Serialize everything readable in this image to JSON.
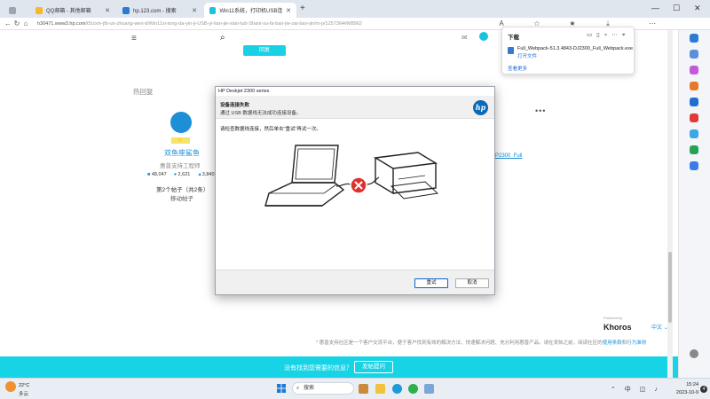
{
  "browser": {
    "tabs": [
      {
        "label": "QQ邮箱 - 其他邮箱",
        "color": "#f6b72a"
      },
      {
        "label": "hp.123.com - 搜索",
        "color": "#2a7ad6"
      },
      {
        "label": "Win11系统，打印机USB连接断开...",
        "color": "#19c3db"
      }
    ],
    "new_tab": "+",
    "url_host": "h30471.www3.hp.com",
    "url_rest": "/t5/zxm-jtb-un-zhuang-wen-ti/Win11xi-tong-da-yin-ji-USB-yi-lian-jie-xian-tub-Shani-su-fa-ban-jie-zai-ban-jin/m-p/1257364#M8962",
    "window_controls": [
      "—",
      "☐",
      "✕"
    ]
  },
  "downloads": {
    "title": "下载",
    "file_name": "Full_Webpack-51.3.4843-DJ2300_Full_Webpack.exe",
    "open_file": "打开文件",
    "see_more": "查看更多"
  },
  "page": {
    "top_button": "回复",
    "section_title": "热回复",
    "user": {
      "badge": "⭐",
      "name": "双鱼座鲨鱼",
      "title": "惠普支持工程师",
      "stats": [
        "48,047",
        "2,621",
        "3,840"
      ],
      "posts": "第2个帖子（共2条）",
      "solved": "移动帖子"
    },
    "more_dots": "•••",
    "link_fragment": "P2300_Full",
    "khoros_pre": "Powered by",
    "khoros": "Khoros",
    "language": "中文",
    "footer_note": "* 惠普支持社区是一个客户交流平台，便于客户找到有效的解决方法、快速解决问题、充分利用惠普产品。请在发帖之前，阅读社区的",
    "footer_link1": "使用条款",
    "footer_and": "和",
    "footer_link2": "行为准则",
    "question": "没有找到您需要的信息？",
    "post_button": "发帖提问"
  },
  "dialog": {
    "window_title": "HP Deskjet 2300 series",
    "heading": "设备连接失败",
    "subheading": "通过 USB 数据线无法成功连接设备。",
    "message": "请检查数据线连接，然后单击\"重试\"再试一次。",
    "logo": "hp",
    "retry": "重试",
    "cancel": "取消"
  },
  "taskbar": {
    "temperature": "22°C",
    "weather": "多云",
    "search": "搜索",
    "time": "15:24",
    "date": "2023-10-9",
    "tray_icons": "⌃ 中 ◫ ♪",
    "notif_count": "4"
  },
  "colors": {
    "accent": "#16d3e6",
    "link": "#1a8fd6",
    "hp_blue": "#0a6ab5",
    "error_red": "#e0312b"
  }
}
